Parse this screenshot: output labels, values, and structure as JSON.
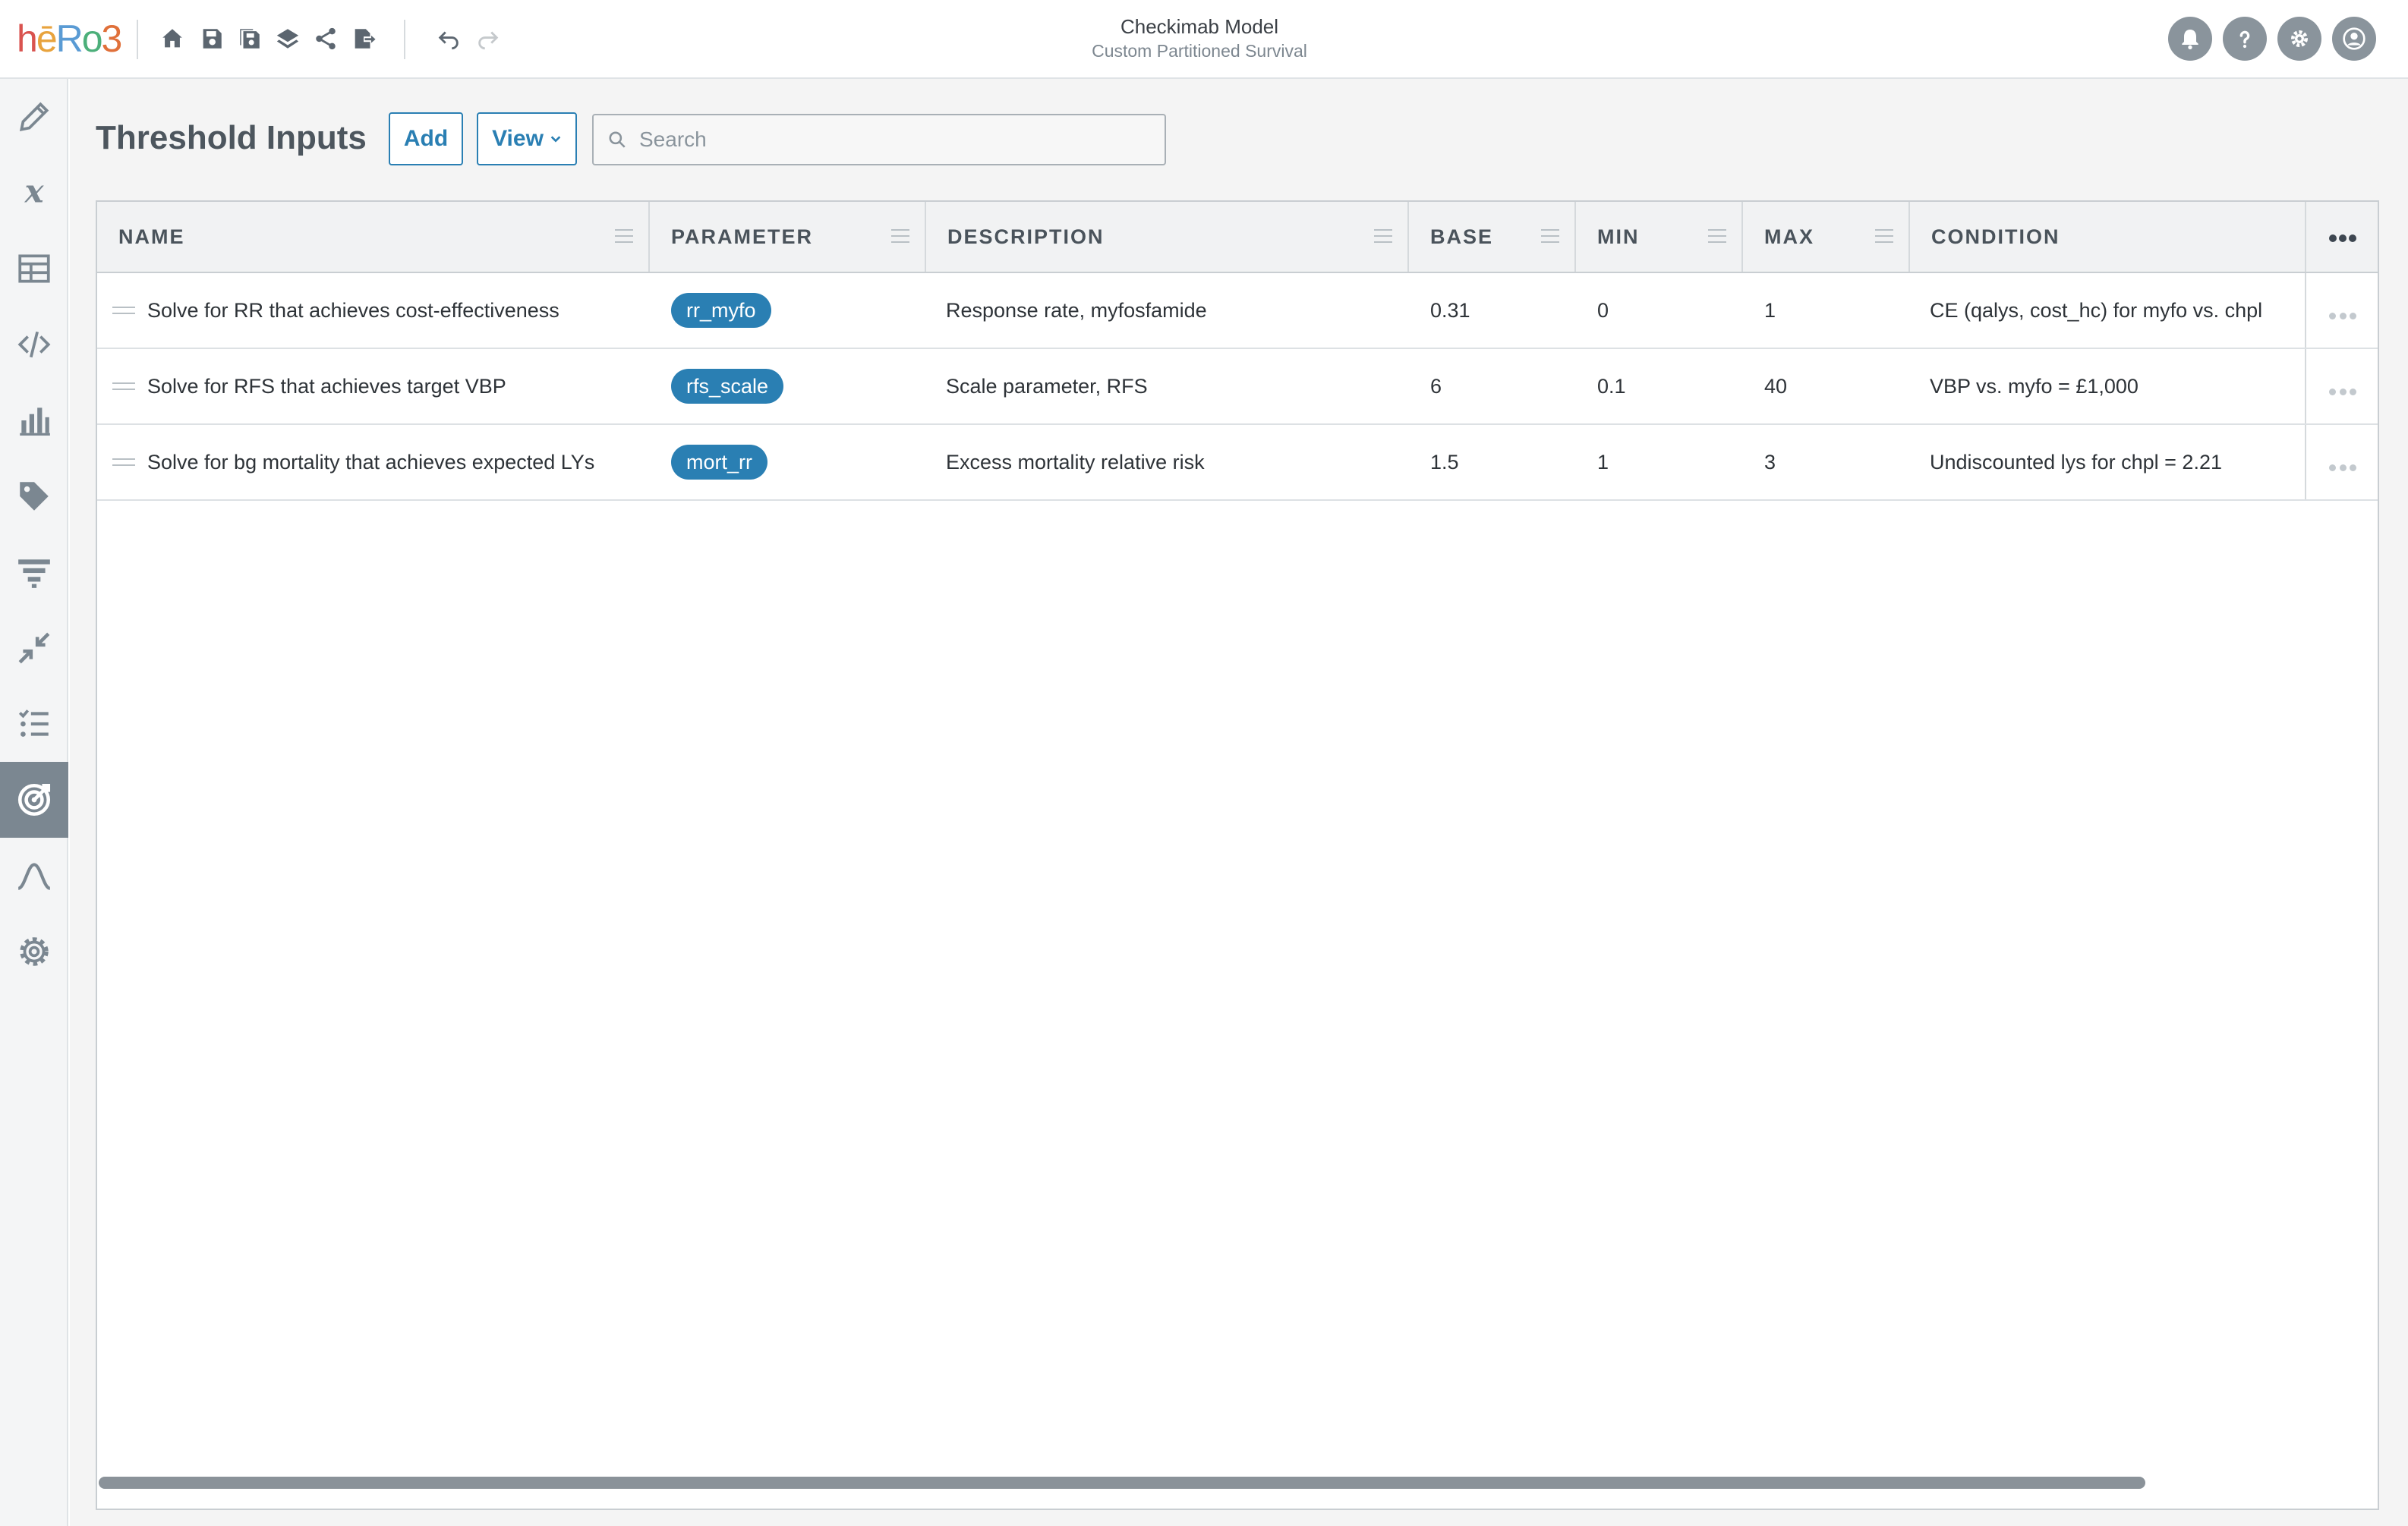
{
  "app": {
    "logo_text": "hēRo3",
    "model_title": "Checkimab Model",
    "model_subtitle": "Custom Partitioned Survival"
  },
  "toolbar": {
    "icons": [
      "home-icon",
      "save-icon",
      "save-as-icon",
      "layers-icon",
      "share-icon",
      "export-icon",
      "undo-icon",
      "redo-icon"
    ]
  },
  "header_right": {
    "icons": [
      "bell-icon",
      "help-icon",
      "gear-icon",
      "user-icon"
    ]
  },
  "sidebar": {
    "items": [
      {
        "icon": "pencil-icon",
        "active": false
      },
      {
        "icon": "variable-x-icon",
        "active": false
      },
      {
        "icon": "table-icon",
        "active": false
      },
      {
        "icon": "code-icon",
        "active": false
      },
      {
        "icon": "bar-chart-icon",
        "active": false
      },
      {
        "icon": "tag-icon",
        "active": false
      },
      {
        "icon": "filter-icon",
        "active": false
      },
      {
        "icon": "compress-icon",
        "active": false
      },
      {
        "icon": "checklist-icon",
        "active": false
      },
      {
        "icon": "target-icon",
        "active": true
      },
      {
        "icon": "curve-icon",
        "active": false
      },
      {
        "icon": "settings-icon",
        "active": false
      }
    ]
  },
  "page": {
    "title": "Threshold Inputs",
    "add_label": "Add",
    "view_label": "View",
    "search_placeholder": "Search"
  },
  "table": {
    "columns": [
      "NAME",
      "PARAMETER",
      "DESCRIPTION",
      "BASE",
      "MIN",
      "MAX",
      "CONDITION"
    ],
    "rows": [
      {
        "name": "Solve for RR that achieves cost-effectiveness",
        "parameter": "rr_myfo",
        "description": "Response rate, myfosfamide",
        "base": "0.31",
        "min": "0",
        "max": "1",
        "condition": "CE (qalys, cost_hc) for myfo vs. chpl"
      },
      {
        "name": "Solve for RFS that achieves target VBP",
        "parameter": "rfs_scale",
        "description": "Scale parameter, RFS",
        "base": "6",
        "min": "0.1",
        "max": "40",
        "condition": "VBP vs. myfo = £1,000"
      },
      {
        "name": "Solve for bg mortality that achieves expected LYs",
        "parameter": "mort_rr",
        "description": "Excess mortality relative risk",
        "base": "1.5",
        "min": "1",
        "max": "3",
        "condition": "Undiscounted lys for chpl = 2.21"
      }
    ]
  },
  "colors": {
    "accent": "#2a7fb3",
    "sidebar_active": "#7b8791"
  }
}
